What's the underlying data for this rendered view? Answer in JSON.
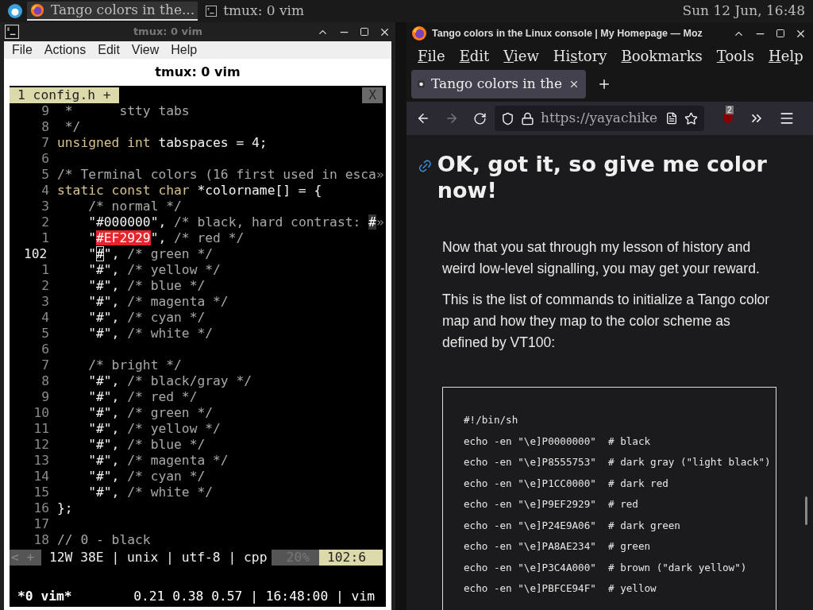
{
  "taskbar": {
    "tasks": [
      {
        "kind": "browser",
        "label": "Tango colors in the...",
        "selected": true
      },
      {
        "kind": "terminal",
        "label": "tmux: 0 vim",
        "selected": false
      }
    ],
    "clock": "Sun 12 Jun, 16:48"
  },
  "terminal": {
    "title": "tmux: 0 vim",
    "menu": [
      "File",
      "Actions",
      "Edit",
      "View",
      "Help"
    ],
    "tab_title": "tmux: 0 vim",
    "vim": {
      "tab": "1 config.h +",
      "close": "X",
      "lines": [
        {
          "number": "9",
          "current": false,
          "segments": [
            {
              "kind": "comment",
              "text": " *      stty tabs"
            }
          ]
        },
        {
          "number": "8",
          "current": false,
          "segments": [
            {
              "kind": "comment",
              "text": " */"
            }
          ]
        },
        {
          "number": "7",
          "current": false,
          "segments": [
            {
              "kind": "type",
              "text": "unsigned int"
            },
            {
              "kind": "plain",
              "text": " tabspaces = 4;"
            }
          ]
        },
        {
          "number": "6",
          "current": false
        },
        {
          "number": "5",
          "current": false,
          "segments": [
            {
              "kind": "comment",
              "text": "/* Terminal colors (16 first used in esca"
            },
            {
              "kind": "more",
              "text": "»"
            }
          ]
        },
        {
          "number": "4",
          "current": false,
          "segments": [
            {
              "kind": "type",
              "text": "static const char"
            },
            {
              "kind": "plain",
              "text": " *colorname[] = {"
            }
          ]
        },
        {
          "number": "3",
          "current": false,
          "segments": [
            {
              "kind": "comment",
              "text": "    /* normal */"
            }
          ]
        },
        {
          "number": "2",
          "current": false,
          "segments": [
            {
              "kind": "plain",
              "text": "    \"#000000\", "
            },
            {
              "kind": "comment",
              "text": "/* black, hard contrast: "
            },
            {
              "kind": "dim-box",
              "text": "#"
            },
            {
              "kind": "more",
              "text": "»"
            }
          ]
        },
        {
          "number": "1",
          "current": false,
          "segments": [
            {
              "kind": "plain",
              "text": "    \""
            },
            {
              "kind": "match",
              "text": "#EF2929"
            },
            {
              "kind": "plain",
              "text": "\", "
            },
            {
              "kind": "comment",
              "text": "/* red */"
            }
          ]
        },
        {
          "number": "102",
          "current": true,
          "segments": [
            {
              "kind": "plain",
              "text": "    \""
            },
            {
              "kind": "cursor",
              "text": "#"
            },
            {
              "kind": "plain",
              "text": "\", "
            },
            {
              "kind": "comment",
              "text": "/* green */"
            }
          ]
        },
        {
          "number": "1",
          "current": false,
          "segments": [
            {
              "kind": "plain",
              "text": "    \"#\", "
            },
            {
              "kind": "comment",
              "text": "/* yellow */"
            }
          ]
        },
        {
          "number": "2",
          "current": false,
          "segments": [
            {
              "kind": "plain",
              "text": "    \"#\", "
            },
            {
              "kind": "comment",
              "text": "/* blue */"
            }
          ]
        },
        {
          "number": "3",
          "current": false,
          "segments": [
            {
              "kind": "plain",
              "text": "    \"#\", "
            },
            {
              "kind": "comment",
              "text": "/* magenta */"
            }
          ]
        },
        {
          "number": "4",
          "current": false,
          "segments": [
            {
              "kind": "plain",
              "text": "    \"#\", "
            },
            {
              "kind": "comment",
              "text": "/* cyan */"
            }
          ]
        },
        {
          "number": "5",
          "current": false,
          "segments": [
            {
              "kind": "plain",
              "text": "    \"#\", "
            },
            {
              "kind": "comment",
              "text": "/* white */"
            }
          ]
        },
        {
          "number": "6",
          "current": false
        },
        {
          "number": "7",
          "current": false,
          "segments": [
            {
              "kind": "comment",
              "text": "    /* bright */"
            }
          ]
        },
        {
          "number": "8",
          "current": false,
          "segments": [
            {
              "kind": "plain",
              "text": "    \"#\", "
            },
            {
              "kind": "comment",
              "text": "/* black/gray */"
            }
          ]
        },
        {
          "number": "9",
          "current": false,
          "segments": [
            {
              "kind": "plain",
              "text": "    \"#\", "
            },
            {
              "kind": "comment",
              "text": "/* red */"
            }
          ]
        },
        {
          "number": "10",
          "current": false,
          "segments": [
            {
              "kind": "plain",
              "text": "    \"#\", "
            },
            {
              "kind": "comment",
              "text": "/* green */"
            }
          ]
        },
        {
          "number": "11",
          "current": false,
          "segments": [
            {
              "kind": "plain",
              "text": "    \"#\", "
            },
            {
              "kind": "comment",
              "text": "/* yellow */"
            }
          ]
        },
        {
          "number": "12",
          "current": false,
          "segments": [
            {
              "kind": "plain",
              "text": "    \"#\", "
            },
            {
              "kind": "comment",
              "text": "/* blue */"
            }
          ]
        },
        {
          "number": "13",
          "current": false,
          "segments": [
            {
              "kind": "plain",
              "text": "    \"#\", "
            },
            {
              "kind": "comment",
              "text": "/* magenta */"
            }
          ]
        },
        {
          "number": "14",
          "current": false,
          "segments": [
            {
              "kind": "plain",
              "text": "    \"#\", "
            },
            {
              "kind": "comment",
              "text": "/* cyan */"
            }
          ]
        },
        {
          "number": "15",
          "current": false,
          "segments": [
            {
              "kind": "plain",
              "text": "    \"#\", "
            },
            {
              "kind": "comment",
              "text": "/* white */"
            }
          ]
        },
        {
          "number": "16",
          "current": false,
          "segments": [
            {
              "kind": "plain",
              "text": "};"
            }
          ]
        },
        {
          "number": "17",
          "current": false
        },
        {
          "number": "18",
          "current": false,
          "segments": [
            {
              "kind": "comment",
              "text": "// 0 - black"
            }
          ]
        }
      ],
      "status": {
        "mode": "< +",
        "info": "12W 38E | unix | utf-8 | cpp",
        "percent": "20%",
        "position": "102:6"
      }
    },
    "tmux": {
      "window": "*0 vim*",
      "right": "0.21 0.38 0.57 | 16:48:00 | vim"
    }
  },
  "browser": {
    "title": "Tango colors in the Linux console | My Homepage — Moz",
    "menu": [
      {
        "accel": "F",
        "rest": "ile"
      },
      {
        "accel": "E",
        "rest": "dit"
      },
      {
        "accel": "V",
        "rest": "iew"
      },
      {
        "pre": "Hi",
        "accel": "s",
        "rest": "tory"
      },
      {
        "accel": "B",
        "rest": "ookmarks"
      },
      {
        "accel": "T",
        "rest": "ools"
      },
      {
        "accel": "H",
        "rest": "elp"
      }
    ],
    "tab": {
      "label": "Tango colors in the",
      "selected": true
    },
    "url": "https://yayachike",
    "extension_badge": "2",
    "heading": "OK, got it, so give me color now!",
    "paragraphs": [
      "Now that you sat through my lesson of history and weird low-level signalling, you may get your reward.",
      "This is the list of commands to initialize a Tango color map and how they map to the color scheme as defined by VT100:"
    ],
    "code": [
      "#!/bin/sh",
      "echo -en \"\\e]P0000000\"  # black",
      "echo -en \"\\e]P8555753\"  # dark gray (\"light black\")",
      "echo -en \"\\e]P1CC0000\"  # dark red",
      "echo -en \"\\e]P9EF2929\"  # red",
      "echo -en \"\\e]P24E9A06\"  # dark green",
      "echo -en \"\\e]PA8AE234\"  # green",
      "echo -en \"\\e]P3C4A000\"  # brown (\"dark yellow\")",
      "echo -en \"\\e]PBFCE94F\"  # yellow"
    ]
  }
}
